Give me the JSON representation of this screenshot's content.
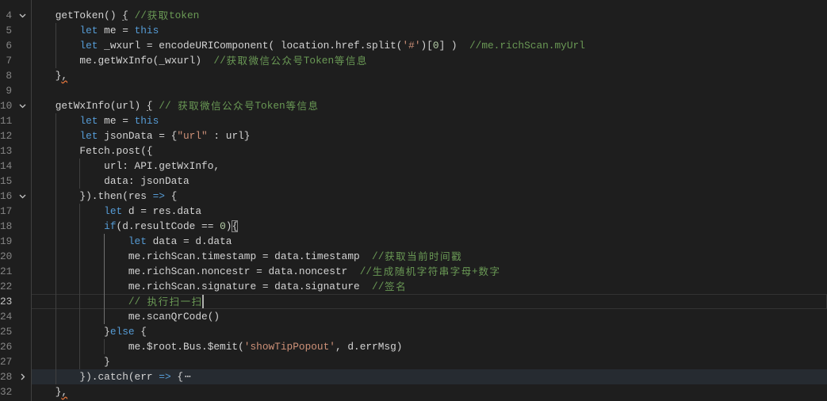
{
  "editor": {
    "theme": {
      "background": "#1e1e1e",
      "text": "#d4d4d4",
      "keyword": "#569cd6",
      "string": "#ce9178",
      "comment": "#6a9955",
      "number": "#b5cea8",
      "line_number": "#858585",
      "line_number_active": "#c6c6c6",
      "warning_squiggle": "#e0743c"
    },
    "lines": [
      {
        "n": "4",
        "fold": "expanded",
        "tokens": [
          {
            "t": "    getToken() "
          },
          {
            "t": "{",
            "deco": "underline"
          },
          {
            "t": " "
          },
          {
            "t": "//获取token",
            "k": "comment"
          }
        ]
      },
      {
        "n": "5",
        "tokens": [
          {
            "t": "        "
          },
          {
            "t": "let",
            "k": "keyword"
          },
          {
            "t": " me = "
          },
          {
            "t": "this",
            "k": "keyword"
          }
        ]
      },
      {
        "n": "6",
        "tokens": [
          {
            "t": "        "
          },
          {
            "t": "let",
            "k": "keyword"
          },
          {
            "t": " _wxurl = encodeURIComponent( location.href.split("
          },
          {
            "t": "'#'",
            "k": "string"
          },
          {
            "t": ")["
          },
          {
            "t": "0",
            "k": "number"
          },
          {
            "t": "] )  "
          },
          {
            "t": "//me.richScan.myUrl",
            "k": "comment"
          }
        ]
      },
      {
        "n": "7",
        "tokens": [
          {
            "t": "        me.getWxInfo(_wxurl)  "
          },
          {
            "t": "//获取微信公众号Token等信息",
            "k": "comment"
          }
        ]
      },
      {
        "n": "8",
        "tokens": [
          {
            "t": "    }"
          },
          {
            "t": ",",
            "deco": "squiggle"
          }
        ]
      },
      {
        "n": "9",
        "tokens": []
      },
      {
        "n": "10",
        "fold": "expanded",
        "tokens": [
          {
            "t": "    getWxInfo(url) "
          },
          {
            "t": "{",
            "deco": "underline"
          },
          {
            "t": " "
          },
          {
            "t": "// 获取微信公众号Token等信息",
            "k": "comment"
          }
        ]
      },
      {
        "n": "11",
        "tokens": [
          {
            "t": "        "
          },
          {
            "t": "let",
            "k": "keyword"
          },
          {
            "t": " me = "
          },
          {
            "t": "this",
            "k": "keyword"
          }
        ]
      },
      {
        "n": "12",
        "tokens": [
          {
            "t": "        "
          },
          {
            "t": "let",
            "k": "keyword"
          },
          {
            "t": " jsonData = {"
          },
          {
            "t": "\"url\"",
            "k": "string"
          },
          {
            "t": " : url}"
          }
        ]
      },
      {
        "n": "13",
        "tokens": [
          {
            "t": "        Fetch.post({"
          }
        ]
      },
      {
        "n": "14",
        "tokens": [
          {
            "t": "            url: API.getWxInfo,"
          }
        ]
      },
      {
        "n": "15",
        "tokens": [
          {
            "t": "            data: jsonData"
          }
        ]
      },
      {
        "n": "16",
        "fold": "expanded",
        "tokens": [
          {
            "t": "        }).then(res "
          },
          {
            "t": "=>",
            "k": "keyword"
          },
          {
            "t": " {"
          }
        ]
      },
      {
        "n": "17",
        "tokens": [
          {
            "t": "            "
          },
          {
            "t": "let",
            "k": "keyword"
          },
          {
            "t": " d = res.data"
          }
        ]
      },
      {
        "n": "18",
        "tokens": [
          {
            "t": "            "
          },
          {
            "t": "if",
            "k": "keyword"
          },
          {
            "t": "(d.resultCode == "
          },
          {
            "t": "0",
            "k": "number"
          },
          {
            "t": ")"
          },
          {
            "t": "{",
            "deco": "box"
          }
        ]
      },
      {
        "n": "19",
        "tokens": [
          {
            "t": "                "
          },
          {
            "t": "let",
            "k": "keyword"
          },
          {
            "t": " data = d.data"
          }
        ]
      },
      {
        "n": "20",
        "tokens": [
          {
            "t": "                me.richScan.timestamp = data.timestamp  "
          },
          {
            "t": "//获取当前时间戳",
            "k": "comment"
          }
        ]
      },
      {
        "n": "21",
        "tokens": [
          {
            "t": "                me.richScan.noncestr = data.noncestr  "
          },
          {
            "t": "//生成随机字符串字母+数字",
            "k": "comment"
          }
        ]
      },
      {
        "n": "22",
        "tokens": [
          {
            "t": "                me.richScan.signature = data.signature  "
          },
          {
            "t": "//签名",
            "k": "comment"
          }
        ]
      },
      {
        "n": "23",
        "active": true,
        "tokens": [
          {
            "t": "                "
          },
          {
            "t": "// 执行扫一扫",
            "k": "comment"
          }
        ]
      },
      {
        "n": "24",
        "tokens": [
          {
            "t": "                me.scanQrCode()"
          }
        ]
      },
      {
        "n": "25",
        "tokens": [
          {
            "t": "            }"
          },
          {
            "t": "else",
            "k": "keyword"
          },
          {
            "t": " {"
          }
        ]
      },
      {
        "n": "26",
        "tokens": [
          {
            "t": "                me.$root.Bus.$emit("
          },
          {
            "t": "'showTipPopout'",
            "k": "string"
          },
          {
            "t": ", d.errMsg)"
          }
        ]
      },
      {
        "n": "27",
        "tokens": [
          {
            "t": "            }"
          }
        ]
      },
      {
        "n": "28",
        "fold": "collapsed",
        "tokens": [
          {
            "t": "        }).catch(err "
          },
          {
            "t": "=>",
            "k": "keyword"
          },
          {
            "t": " {"
          },
          {
            "t": "⋯",
            "deco": "fold"
          }
        ]
      },
      {
        "n": "32",
        "tokens": [
          {
            "t": "    }"
          },
          {
            "t": ",",
            "deco": "squiggle"
          }
        ]
      }
    ]
  }
}
